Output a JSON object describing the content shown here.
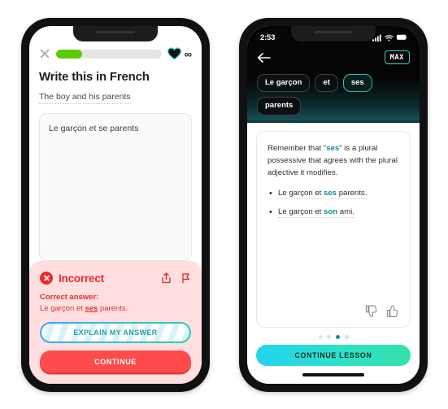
{
  "left_phone": {
    "header": {
      "close_icon": "close-x-icon",
      "progress_percent": 25,
      "hearts_icon": "heart-icon",
      "hearts_value": "∞"
    },
    "exercise": {
      "title": "Write this in French",
      "prompt": "The boy and his parents",
      "user_answer": "Le garçon et se parents"
    },
    "feedback": {
      "status": "Incorrect",
      "status_icon": "x-circle-icon",
      "share_icon": "share-icon",
      "flag_icon": "flag-icon",
      "correct_label": "Correct answer:",
      "correct_answer_prefix": "Le garçon et ",
      "correct_answer_highlight": "ses",
      "correct_answer_suffix": " parents.",
      "explain_button": "EXPLAIN MY ANSWER",
      "continue_button": "CONTINUE",
      "banner_color": "#ffdfe0",
      "accent_color": "#ea2b2b",
      "continue_color": "#ff4b4b"
    }
  },
  "right_phone": {
    "status_bar": {
      "time": "2:53",
      "signal_icon": "cellular-signal-icon",
      "wifi_icon": "wifi-icon",
      "battery_icon": "battery-icon"
    },
    "nav": {
      "back_icon": "back-arrow-icon",
      "badge_label": "MAX",
      "badge_color": "#2fd3c4"
    },
    "chips": [
      {
        "label": "Le garçon",
        "active": false
      },
      {
        "label": "et",
        "active": false
      },
      {
        "label": "ses",
        "active": true
      },
      {
        "label": "parents",
        "active": false
      }
    ],
    "explanation": {
      "paragraph_part1": "Remember that \"",
      "paragraph_highlight": "ses",
      "paragraph_part2": "\" is a plural possessive that agrees with the plural adjective it modifies.",
      "examples": [
        {
          "prefix": "Le garçon et ",
          "highlight": "ses",
          "suffix": " parents."
        },
        {
          "prefix": "Le garçon et ",
          "highlight": "son",
          "suffix": " ami."
        }
      ],
      "thumbs_down_icon": "thumbs-down-icon",
      "thumbs_up_icon": "thumbs-up-icon",
      "highlight_color": "#0c8ba1"
    },
    "pagination": {
      "total": 4,
      "active_index": 2
    },
    "continue_button": "CONTINUE LESSON"
  }
}
